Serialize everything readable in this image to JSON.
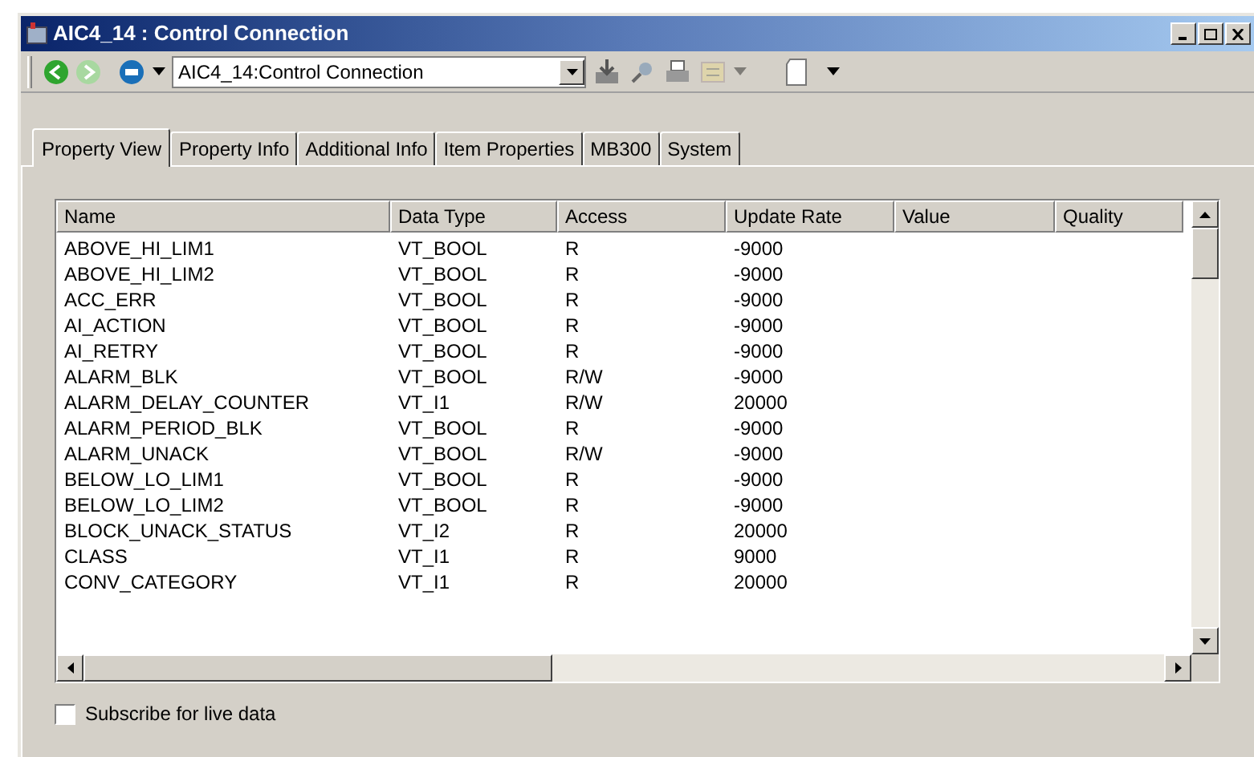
{
  "window": {
    "title": "AIC4_14 : Control Connection"
  },
  "toolbar": {
    "address": "AIC4_14:Control Connection"
  },
  "tabs": [
    {
      "label": "Property View",
      "selected": true
    },
    {
      "label": "Property Info",
      "selected": false
    },
    {
      "label": "Additional Info",
      "selected": false
    },
    {
      "label": "Item Properties",
      "selected": false
    },
    {
      "label": "MB300",
      "selected": false
    },
    {
      "label": "System",
      "selected": false
    }
  ],
  "table": {
    "columns": [
      "Name",
      "Data Type",
      "Access",
      "Update Rate",
      "Value",
      "Quality"
    ],
    "rows": [
      [
        "ABOVE_HI_LIM1",
        "VT_BOOL",
        "R",
        "-9000"
      ],
      [
        "ABOVE_HI_LIM2",
        "VT_BOOL",
        "R",
        "-9000"
      ],
      [
        "ACC_ERR",
        "VT_BOOL",
        "R",
        "-9000"
      ],
      [
        "AI_ACTION",
        "VT_BOOL",
        "R",
        "-9000"
      ],
      [
        "AI_RETRY",
        "VT_BOOL",
        "R",
        "-9000"
      ],
      [
        "ALARM_BLK",
        "VT_BOOL",
        "R/W",
        "-9000"
      ],
      [
        "ALARM_DELAY_COUNTER",
        "VT_I1",
        "R/W",
        "20000"
      ],
      [
        "ALARM_PERIOD_BLK",
        "VT_BOOL",
        "R",
        "-9000"
      ],
      [
        "ALARM_UNACK",
        "VT_BOOL",
        "R/W",
        "-9000"
      ],
      [
        "BELOW_LO_LIM1",
        "VT_BOOL",
        "R",
        "-9000"
      ],
      [
        "BELOW_LO_LIM2",
        "VT_BOOL",
        "R",
        "-9000"
      ],
      [
        "BLOCK_UNACK_STATUS",
        "VT_I2",
        "R",
        "20000"
      ],
      [
        "CLASS",
        "VT_I1",
        "R",
        "9000"
      ],
      [
        "CONV_CATEGORY",
        "VT_I1",
        "R",
        "20000"
      ]
    ]
  },
  "subscribe": {
    "label": "Subscribe for live data",
    "checked": false
  }
}
